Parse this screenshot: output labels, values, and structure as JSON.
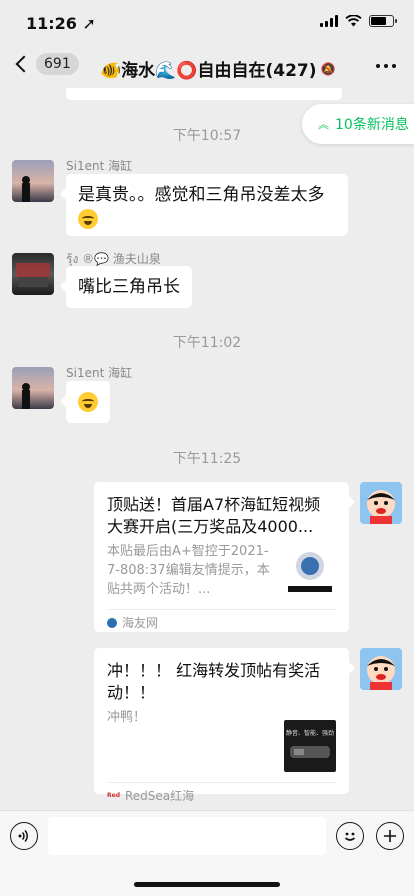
{
  "status_bar": {
    "time": "11:26 ➚",
    "battery_level": 0.75
  },
  "nav": {
    "back_count": "691",
    "title": "🐠海水🌊⭕自由自在(427)",
    "mute_icon": "mute-bell-icon",
    "more_icon": "more-icon"
  },
  "new_messages": {
    "label": "10条新消息"
  },
  "timestamps": {
    "t1": "下午10:57",
    "t2": "下午11:02",
    "t3": "下午11:25"
  },
  "messages": {
    "m1": {
      "sender": "Si1ent 海缸",
      "text": "是真贵。。感觉和三角吊没差太多"
    },
    "m2": {
      "sender": "รุ้ง ®💬 渔夫山泉",
      "text": "嘴比三角吊长"
    },
    "m3": {
      "sender": "Si1ent 海缸"
    }
  },
  "cards": {
    "c1": {
      "title": "顶贴送！首届A7杯海缸短视频大赛开启(三万奖品及4000...",
      "desc": "本贴最后由A+智控于2021-7-808:37编辑友情提示，本贴共两个活动！...",
      "source": "海友网"
    },
    "c2": {
      "title": "冲！！！ 红海转发顶帖有奖活动！！",
      "desc": "冲鸭！",
      "source": "RedSea红海",
      "thumb_text": "静音、智能、强劲"
    }
  },
  "input": {
    "placeholder": ""
  },
  "colors": {
    "accent": "#07c160",
    "background": "#ededed",
    "bubble": "#ffffff"
  }
}
